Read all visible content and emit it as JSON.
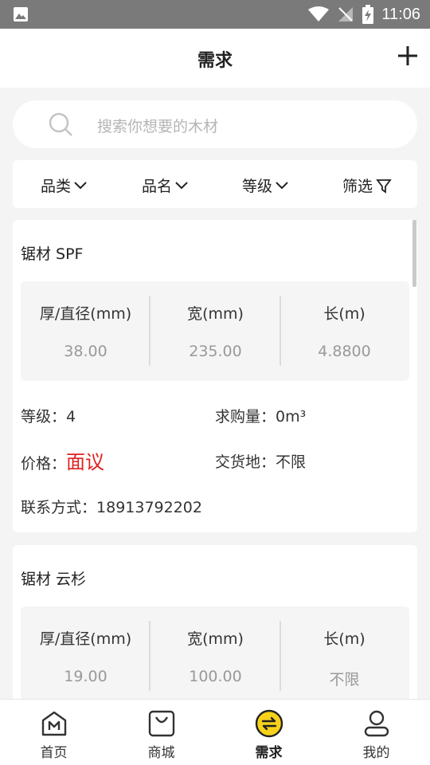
{
  "statusbar": {
    "time": "11:06"
  },
  "header": {
    "title": "需求"
  },
  "search": {
    "placeholder": "搜索你想要的木材"
  },
  "filters": [
    "品类",
    "品名",
    "等级",
    "筛选"
  ],
  "cards": [
    {
      "name": "锯材 SPF",
      "spec_labels": [
        "厚/直径(mm)",
        "宽(mm)",
        "长(m)"
      ],
      "spec_values": [
        "38.00",
        "235.00",
        "4.8800"
      ],
      "grade_label": "等级：",
      "grade": "4",
      "qty_label": "求购量：",
      "qty": "0m³",
      "price_label": "价格：",
      "price": "面议",
      "delivery_label": "交货地：",
      "delivery": "不限",
      "contact_label": "联系方式：",
      "contact": "18913792202"
    },
    {
      "name": "锯材 云杉",
      "spec_labels": [
        "厚/直径(mm)",
        "宽(mm)",
        "长(m)"
      ],
      "spec_values": [
        "19.00",
        "100.00",
        "不限"
      ]
    }
  ],
  "tabs": [
    "首页",
    "商城",
    "需求",
    "我的"
  ],
  "colors": {
    "accent": "#f7d21a",
    "price": "#e02020"
  }
}
